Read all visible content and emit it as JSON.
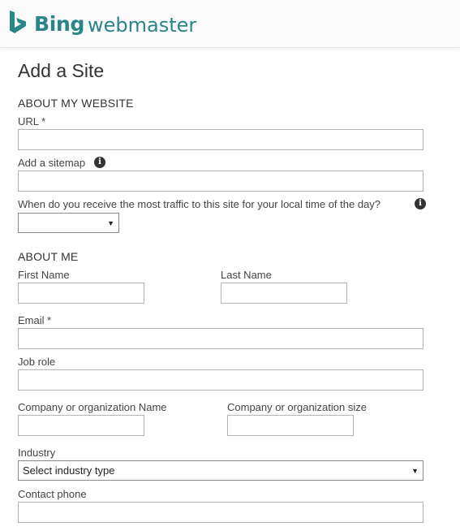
{
  "header": {
    "brand": "Bing",
    "product": "webmaster"
  },
  "page_title": "Add a Site",
  "about_website": {
    "heading": "ABOUT MY WEBSITE",
    "url_label": "URL *",
    "url_value": "",
    "sitemap_label": "Add a sitemap",
    "sitemap_value": "",
    "traffic_label": "When do you receive the most traffic to this site for your local time of the day?",
    "traffic_selected": ""
  },
  "about_me": {
    "heading": "ABOUT ME",
    "first_name_label": "First Name",
    "last_name_label": "Last Name",
    "email_label": "Email *",
    "job_role_label": "Job role",
    "company_name_label": "Company or organization Name",
    "company_size_label": "Company or organization size",
    "industry_label": "Industry",
    "industry_selected": "Select industry type",
    "phone_label": "Contact phone"
  },
  "colors": {
    "brand": "#2a8586",
    "text": "#333333",
    "border": "#b4b4b4"
  },
  "icons": {
    "logo": "bing-logo-icon",
    "info": "info-icon",
    "dropdown": "caret-down-icon"
  }
}
